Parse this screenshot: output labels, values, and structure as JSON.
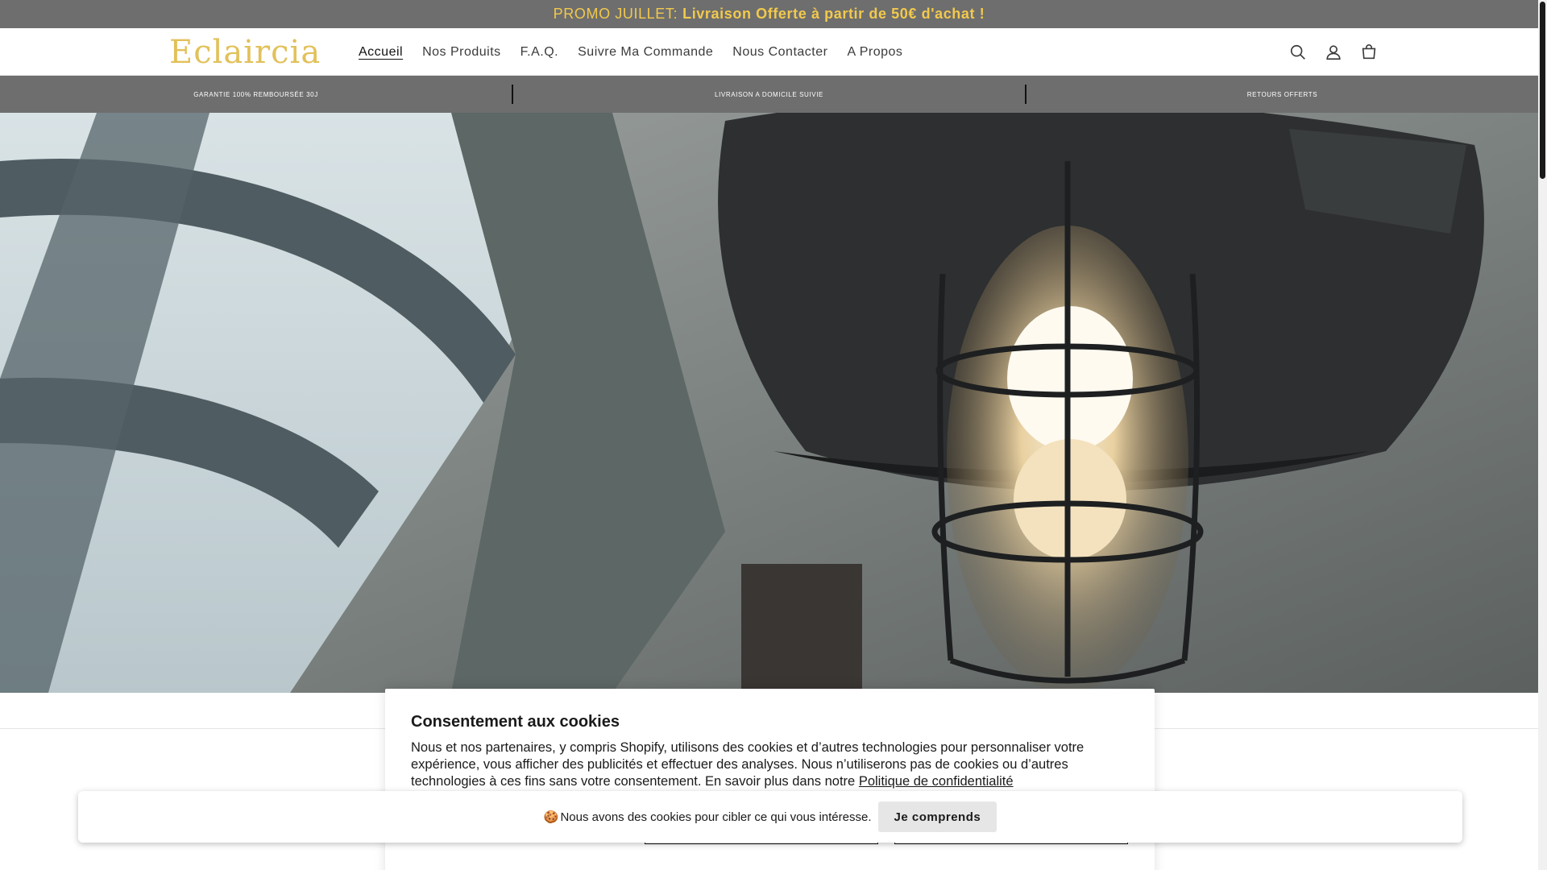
{
  "promo": {
    "prefix": "PROMO JUILLET:",
    "text": "Livraison Offerte à partir de 50€ d'achat !"
  },
  "header": {
    "logo": "Eclaircia",
    "nav": [
      {
        "label": "Accueil",
        "active": true
      },
      {
        "label": "Nos Produits"
      },
      {
        "label": "F.A.Q."
      },
      {
        "label": "Suivre Ma Commande"
      },
      {
        "label": "Nous Contacter"
      },
      {
        "label": "A Propos"
      }
    ],
    "icons": [
      "search-icon",
      "account-icon",
      "cart-icon"
    ]
  },
  "usp": [
    "GARANTIE 100% REMBOURSÉE 30J",
    "LIVRAISON A DOMICILE SUIVIE",
    "RETOURS OFFERTS"
  ],
  "cookie_modal": {
    "title": "Consentement aux cookies",
    "text": "Nous et nos partenaires, y compris Shopify, utilisons des cookies et d’autres technologies pour personnaliser votre expérience, vous afficher des publicités et effectuer des analyses. Nous n’utiliserons pas de cookies ou d’autres technologies à ces fins sans votre consentement. En savoir plus dans notre",
    "link": "Politique de confidentialité"
  },
  "cookie_bar": {
    "glyph": "🍪",
    "text": "Nous avons des cookies pour cibler ce qui vous intéresse.",
    "accept_label": "Je comprends"
  },
  "colors": {
    "promo_bg": "#6e6e6e",
    "promo_text": "#f2c94c",
    "logo": "#e2c15a"
  }
}
